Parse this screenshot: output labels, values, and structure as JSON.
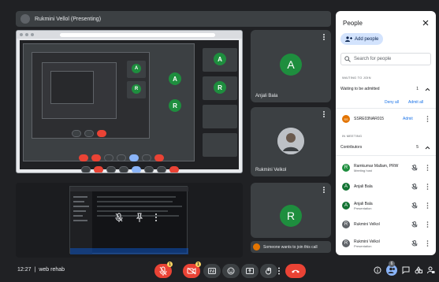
{
  "presenter_banner": {
    "text": "Rukmini Vellol (Presenting)"
  },
  "tiles": {
    "anjali": {
      "initial": "A",
      "name": "Anjali Bala",
      "color": "#1e8e3e"
    },
    "rukmini": {
      "name": "Rukmini Velkol"
    },
    "r_tile": {
      "initial": "R",
      "color": "#1e8e3e"
    }
  },
  "notification": {
    "text": "Someone wants to join this call"
  },
  "bottom": {
    "time": "12:27",
    "separator": "|",
    "meeting_code": "web rehab",
    "mic_badge": "1",
    "cam_badge": "1",
    "people_count": "6"
  },
  "people_panel": {
    "title": "People",
    "add_label": "Add people",
    "search_placeholder": "Search for people",
    "waiting_section": "WAITING TO JOIN",
    "waiting_row": {
      "label": "Waiting to be admitted",
      "count": "1"
    },
    "deny_all": "Deny all",
    "admit_all": "Admit all",
    "waiting_person": {
      "initial": "SS",
      "name": "SSRE03NAR015",
      "admit": "Admit"
    },
    "in_meeting_section": "IN MEETING",
    "contributors": {
      "label": "Contributors",
      "count": "5"
    },
    "people": [
      {
        "initial": "R",
        "name": "Ramkumar Mallam, PRW",
        "sub": "Meeting host",
        "color": "#1e8e3e"
      },
      {
        "initial": "A",
        "name": "Anjali Bala",
        "sub": "",
        "color": "#137333"
      },
      {
        "initial": "A",
        "name": "Anjali Bala",
        "sub": "Presentation",
        "color": "#137333"
      },
      {
        "initial": "R",
        "name": "Rukmini Velkol",
        "sub": "",
        "color": "#5f6368"
      },
      {
        "initial": "R",
        "name": "Rukmini Velkol",
        "sub": "Presentation",
        "color": "#5f6368"
      }
    ]
  },
  "colors": {
    "accent": "#1a73e8",
    "leave": "#ea4335",
    "panel_bg": "#ffffff",
    "bg": "#202124"
  }
}
